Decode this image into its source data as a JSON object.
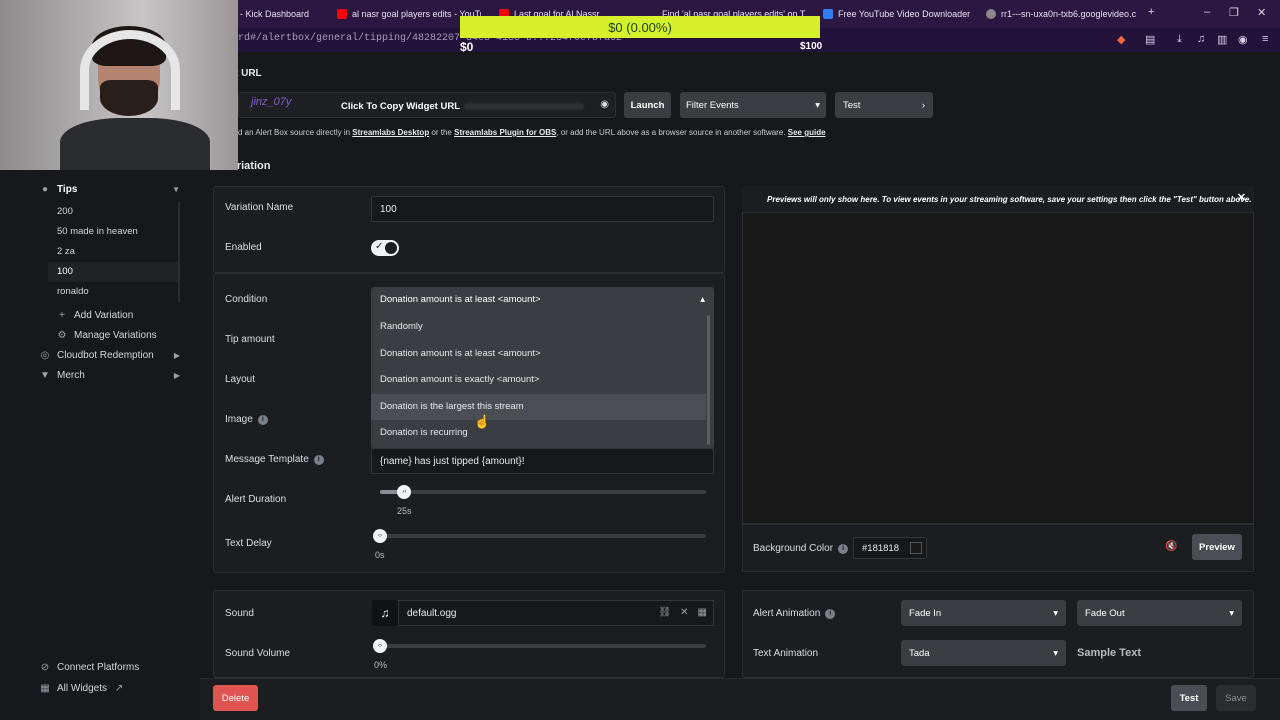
{
  "browser": {
    "tabs": [
      {
        "title": "- Kick Dashboard",
        "color": "#53fc18"
      },
      {
        "title": "al nasr goal players edits - YouTube",
        "color": "#ff0000"
      },
      {
        "title": "Last goal for Al Nassr",
        "color": "#ff0000"
      },
      {
        "title": "Find 'al nasr goal players edits' on T",
        "color": "#ffffff"
      },
      {
        "title": "Free YouTube Video Downloader",
        "color": "#2f7df6"
      },
      {
        "title": "rr1---sn-uxa0n-txb6.googlevideo.co",
        "color": "#aaaaaa"
      }
    ],
    "url": "rd#/alertbox/general/tipping/48282207-d4e8-4188-b...234f0e7bfa62"
  },
  "goal": {
    "amount": "$0 (0.00%)",
    "min": "$0",
    "max": "$100"
  },
  "sidebar": {
    "tips_label": "Tips",
    "variations": [
      "200",
      "50 made in heaven",
      "2 za",
      "100",
      "ronaldo"
    ],
    "active_variation": "100",
    "add_variation": "Add Variation",
    "manage_variations": "Manage Variations",
    "cloudbot": "Cloudbot Redemption",
    "merch": "Merch",
    "connect_platforms": "Connect Platforms",
    "all_widgets": "All Widgets"
  },
  "widget": {
    "title": "t URL",
    "streamer_name": "jinz_07y",
    "copy_label": "Click To Copy Widget URL",
    "launch": "Launch",
    "filter_events": "Filter Events",
    "test": "Test",
    "help_pre": "d an Alert Box source directly in ",
    "help_link1": "Streamlabs Desktop",
    "help_mid": " or the ",
    "help_link2": "Streamlabs Plugin for OBS",
    "help_post": ", or add the URL above as a browser source in another software. ",
    "help_link3": "See guide"
  },
  "variation": {
    "header": "Variation",
    "name_label": "Variation Name",
    "name_value": "100",
    "enabled_label": "Enabled",
    "enabled": true,
    "condition_label": "Condition",
    "condition_value": "Donation amount is at least <amount>",
    "condition_options": [
      "Randomly",
      "Donation amount is at least <amount>",
      "Donation amount is exactly <amount>",
      "Donation is the largest this stream",
      "Donation is recurring"
    ],
    "hovered_option": "Donation is the largest this stream",
    "tip_amount_label": "Tip amount",
    "layout_label": "Layout",
    "image_label": "Image",
    "message_template_label": "Message Template",
    "message_template_value": "{name} has just tipped {amount}!",
    "alert_duration_label": "Alert Duration",
    "alert_duration_value": "25s",
    "alert_duration_fraction": 0.075,
    "text_delay_label": "Text Delay",
    "text_delay_value": "0s",
    "text_delay_fraction": 0
  },
  "preview": {
    "note": "Previews will only show here. To view events in your streaming software, save your settings then click the \"Test\" button above.",
    "bg_color_label": "Background Color",
    "bg_color_value": "#181818",
    "preview_button": "Preview"
  },
  "sound": {
    "label": "Sound",
    "file": "default.ogg",
    "volume_label": "Sound Volume",
    "volume_value": "0%",
    "volume_fraction": 0
  },
  "animation": {
    "alert_label": "Alert Animation",
    "in_value": "Fade In",
    "out_value": "Fade Out",
    "text_label": "Text Animation",
    "text_value": "Tada",
    "sample_text": "Sample Text"
  },
  "footer": {
    "delete": "Delete",
    "test": "Test",
    "save": "Save"
  }
}
